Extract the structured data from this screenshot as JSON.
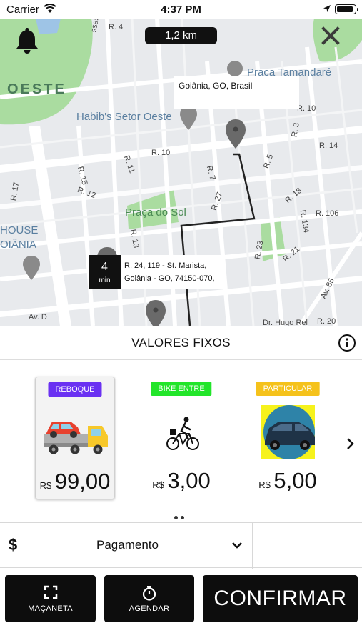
{
  "status_bar": {
    "carrier": "Carrier",
    "time": "4:37 PM"
  },
  "map": {
    "distance": "1,2 km",
    "origin_tooltip": "Goiânia, GO, Brasil",
    "eta": {
      "value": "4",
      "unit": "min"
    },
    "destination_line1": "R. 24, 119 - St. Marista,",
    "destination_line2": "Goiânia - GO, 74150-070,",
    "labels": {
      "oeste": "OESTE",
      "praca_tamandare": "Praça Tamandaré",
      "habibs": "Habib's Setor Oeste",
      "praca_do_sol": "Praça do Sol",
      "house": "HOUSE",
      "goiania": "OIÂNIA",
      "r4": "R. 4",
      "r10a": "R. 10",
      "r10b": "R. 10",
      "r3": "R. 3",
      "r14": "R. 14",
      "r11": "R. 11",
      "r15": "R. 15",
      "r12": "R. 12",
      "r17": "R. 17",
      "r7": "R. 7",
      "r5": "R. 5",
      "r18": "R. 18",
      "r27": "R. 27",
      "r106": "R. 106",
      "r134": "R. 134",
      "r13": "R. 13",
      "r23": "R. 23",
      "r21": "R. 21",
      "av85": "Av. 85",
      "avd": "Av. D",
      "hugo": "Dr. Hugo Rel",
      "r20": "R. 20",
      "ssas": "ssas"
    }
  },
  "panel": {
    "title": "VALORES FIXOS",
    "cards": [
      {
        "tag": "REBOQUE",
        "tag_color": "#6a31f2",
        "currency": "R$",
        "value": "99,00",
        "icon": "tow-truck-icon"
      },
      {
        "tag": "BIKE ENTRE",
        "tag_color": "#22e52a",
        "currency": "R$",
        "value": "3,00",
        "icon": "bicycle-courier-icon"
      },
      {
        "tag": "PARTICULAR",
        "tag_color": "#f5c21b",
        "currency": "R$",
        "value": "5,00",
        "icon": "car-icon"
      }
    ],
    "payment": {
      "symbol": "$",
      "label": "Pagamento"
    },
    "buttons": {
      "macaneta": "MAÇANETA",
      "agendar": "AGENDAR",
      "confirmar": "CONFIRMAR"
    }
  }
}
